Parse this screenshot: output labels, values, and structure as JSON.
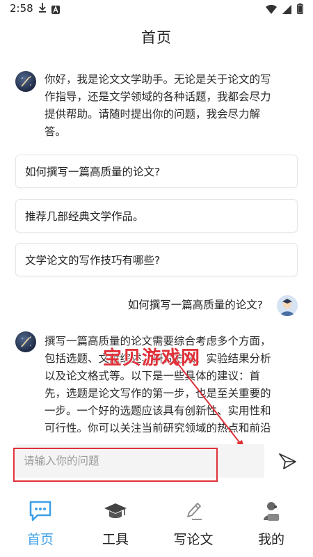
{
  "status_bar": {
    "time": "2:58"
  },
  "header": {
    "title": "首页"
  },
  "bot_intro": {
    "lines": [
      "你好，我是论文文学助手。无论是关于论文的写",
      "作指导，还是文学领域的各种话题，我都会尽力",
      "提供帮助。请随时提出你的问题，我会尽力解",
      "答。"
    ]
  },
  "suggestions": [
    "如何撰写一篇高质量的论文?",
    "推荐几部经典文学作品。",
    "文学论文的写作技巧有哪些?"
  ],
  "user_message": "如何撰写一篇高质量的论文?",
  "bot_reply": {
    "lines": [
      "撰写一篇高质量的论文需要综合考虑多个方面，",
      "包括选题、文献综述、研究方法、实验结果分析",
      "以及论文格式等。以下是一些具体的建议：首",
      "先，选题是论文写作的第一步，也是至关重要的",
      "一步。一个好的选题应该具有创新性、实用性和",
      "可行性。你可以关注当前研究领域的热点和前沿"
    ]
  },
  "watermark": "宝贝游戏网",
  "input": {
    "placeholder": "请输入你的问题"
  },
  "tabs": [
    {
      "label": "首页",
      "icon": "chat-bubble-icon",
      "active": true
    },
    {
      "label": "工具",
      "icon": "graduation-cap-icon",
      "active": false
    },
    {
      "label": "写论文",
      "icon": "pencil-icon",
      "active": false
    },
    {
      "label": "我的",
      "icon": "user-icon",
      "active": false
    }
  ],
  "colors": {
    "accent": "#3fa0e8",
    "annotation_red": "#e0313a"
  }
}
